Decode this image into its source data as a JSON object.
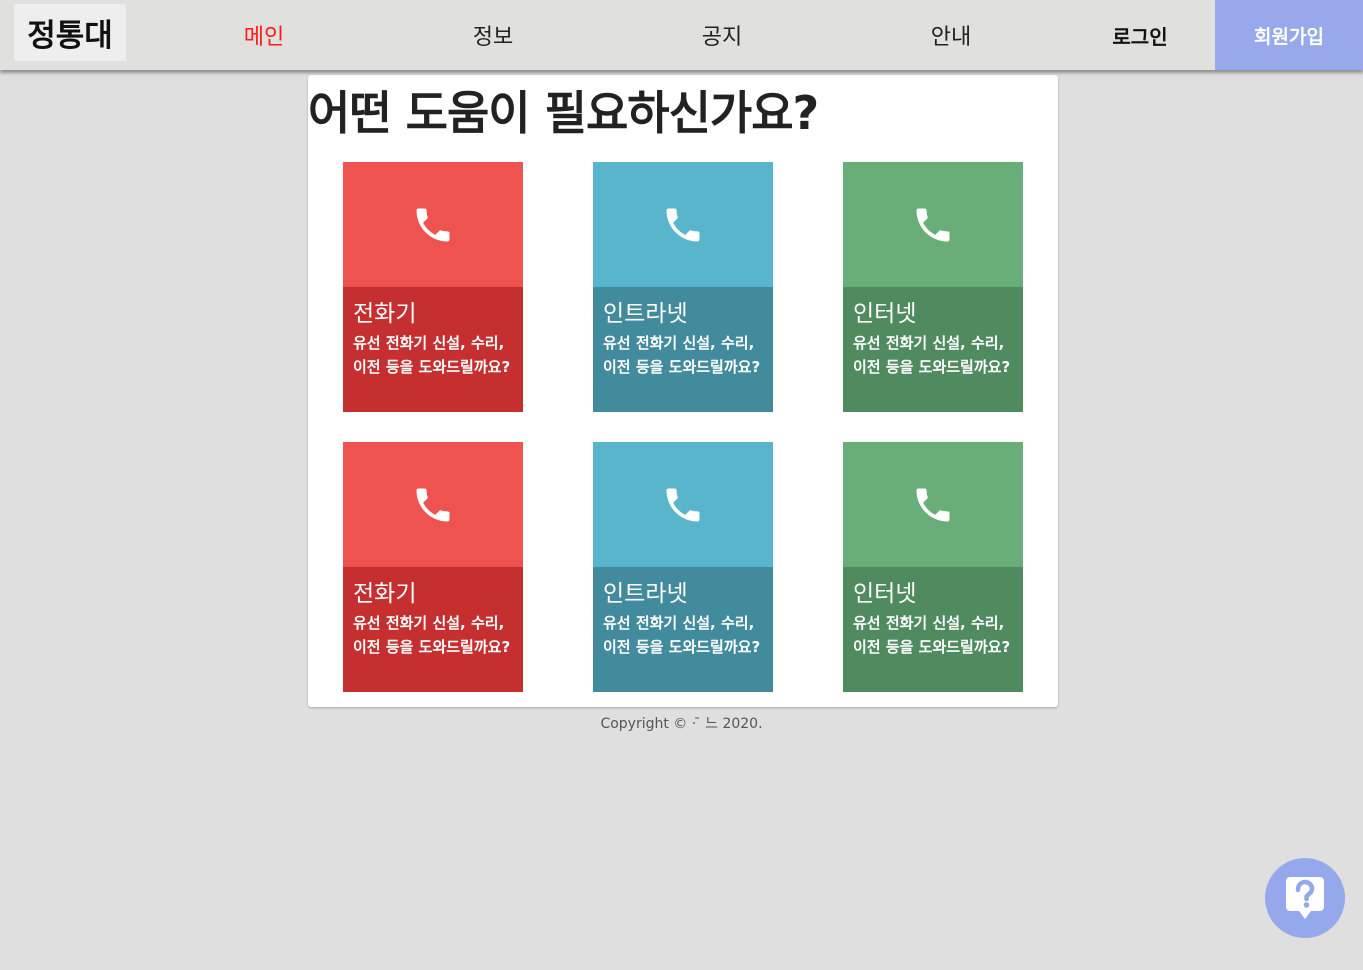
{
  "nav": {
    "logo": "정통대",
    "links": [
      "메인",
      "정보",
      "공지",
      "안내"
    ],
    "login": "로그인",
    "signup": "회원가입"
  },
  "main": {
    "title": "어떤 도움이 필요하신가요?",
    "cards": [
      {
        "title": "전화기",
        "desc": "유선 전화기 신설, 수리, 이전 등을 도와드릴까요?",
        "icon": "phone-icon",
        "theme": "red"
      },
      {
        "title": "인트라넷",
        "desc": "유선 전화기 신설, 수리, 이전 등을 도와드릴까요?",
        "icon": "phone-icon",
        "theme": "blue"
      },
      {
        "title": "인터넷",
        "desc": "유선 전화기 신설, 수리, 이전 등을 도와드릴까요?",
        "icon": "phone-icon",
        "theme": "green"
      },
      {
        "title": "전화기",
        "desc": "유선 전화기 신설, 수리, 이전 등을 도와드릴까요?",
        "icon": "phone-icon",
        "theme": "red"
      },
      {
        "title": "인트라넷",
        "desc": "유선 전화기 신설, 수리, 이전 등을 도와드릴까요?",
        "icon": "phone-icon",
        "theme": "blue"
      },
      {
        "title": "인터넷",
        "desc": "유선 전화기 신설, 수리, 이전 등을 도와드릴까요?",
        "icon": "phone-icon",
        "theme": "green"
      }
    ]
  },
  "footer": {
    "copyright": "Copyright © ·  ̄ 느 2020."
  },
  "help": {
    "icon": "help-question-icon"
  },
  "colors": {
    "nav_bg": "#e0e1df",
    "active_link": "#ff1a1a",
    "signup_bg": "#97a9eb",
    "red_top": "#ef5350",
    "red_bottom": "#c62f2f",
    "blue_top": "#58b5cc",
    "blue_bottom": "#418b9d",
    "green_top": "#69ae79",
    "green_bottom": "#508a5f"
  }
}
